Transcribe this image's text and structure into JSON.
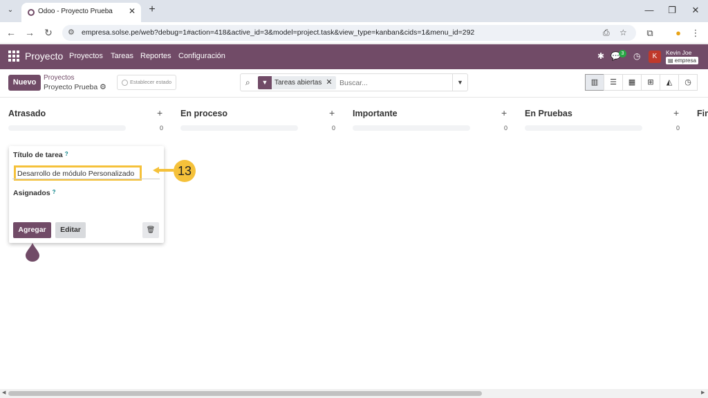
{
  "browser": {
    "tab_title": "Odoo - Proyecto Prueba",
    "new_tab": "+",
    "tab_close": "✕",
    "url": "empresa.solse.pe/web?debug=1#action=418&active_id=3&model=project.task&view_type=kanban&cids=1&menu_id=292"
  },
  "navbar": {
    "app_name": "Proyecto",
    "menus": [
      "Proyectos",
      "Tareas",
      "Reportes",
      "Configuración"
    ],
    "message_count": "3",
    "avatar_letter": "K",
    "user_name": "Kevin Joe",
    "database": "empresa"
  },
  "control_panel": {
    "new_button": "Nuevo",
    "breadcrumb_parent": "Proyectos",
    "breadcrumb_current": "Proyecto Prueba",
    "status_button": "Establecer estado",
    "facet_label": "Tareas abiertas",
    "search_placeholder": "Buscar..."
  },
  "kanban": {
    "columns": [
      {
        "title": "Atrasado",
        "count": "0"
      },
      {
        "title": "En proceso",
        "count": "0"
      },
      {
        "title": "Importante",
        "count": "0"
      },
      {
        "title": "En Pruebas",
        "count": "0"
      },
      {
        "title": "Fin",
        "count": ""
      }
    ]
  },
  "quick_create": {
    "title_label": "Título de tarea",
    "help_mark": "?",
    "title_value": "Desarrollo de módulo Personalizado",
    "assignees_label": "Asignados",
    "add_button": "Agregar",
    "edit_button": "Editar"
  },
  "annotation": {
    "step_number": "13",
    "color": "#f5c13a"
  },
  "colors": {
    "brand": "#714b67",
    "highlight": "#f5c13a"
  }
}
